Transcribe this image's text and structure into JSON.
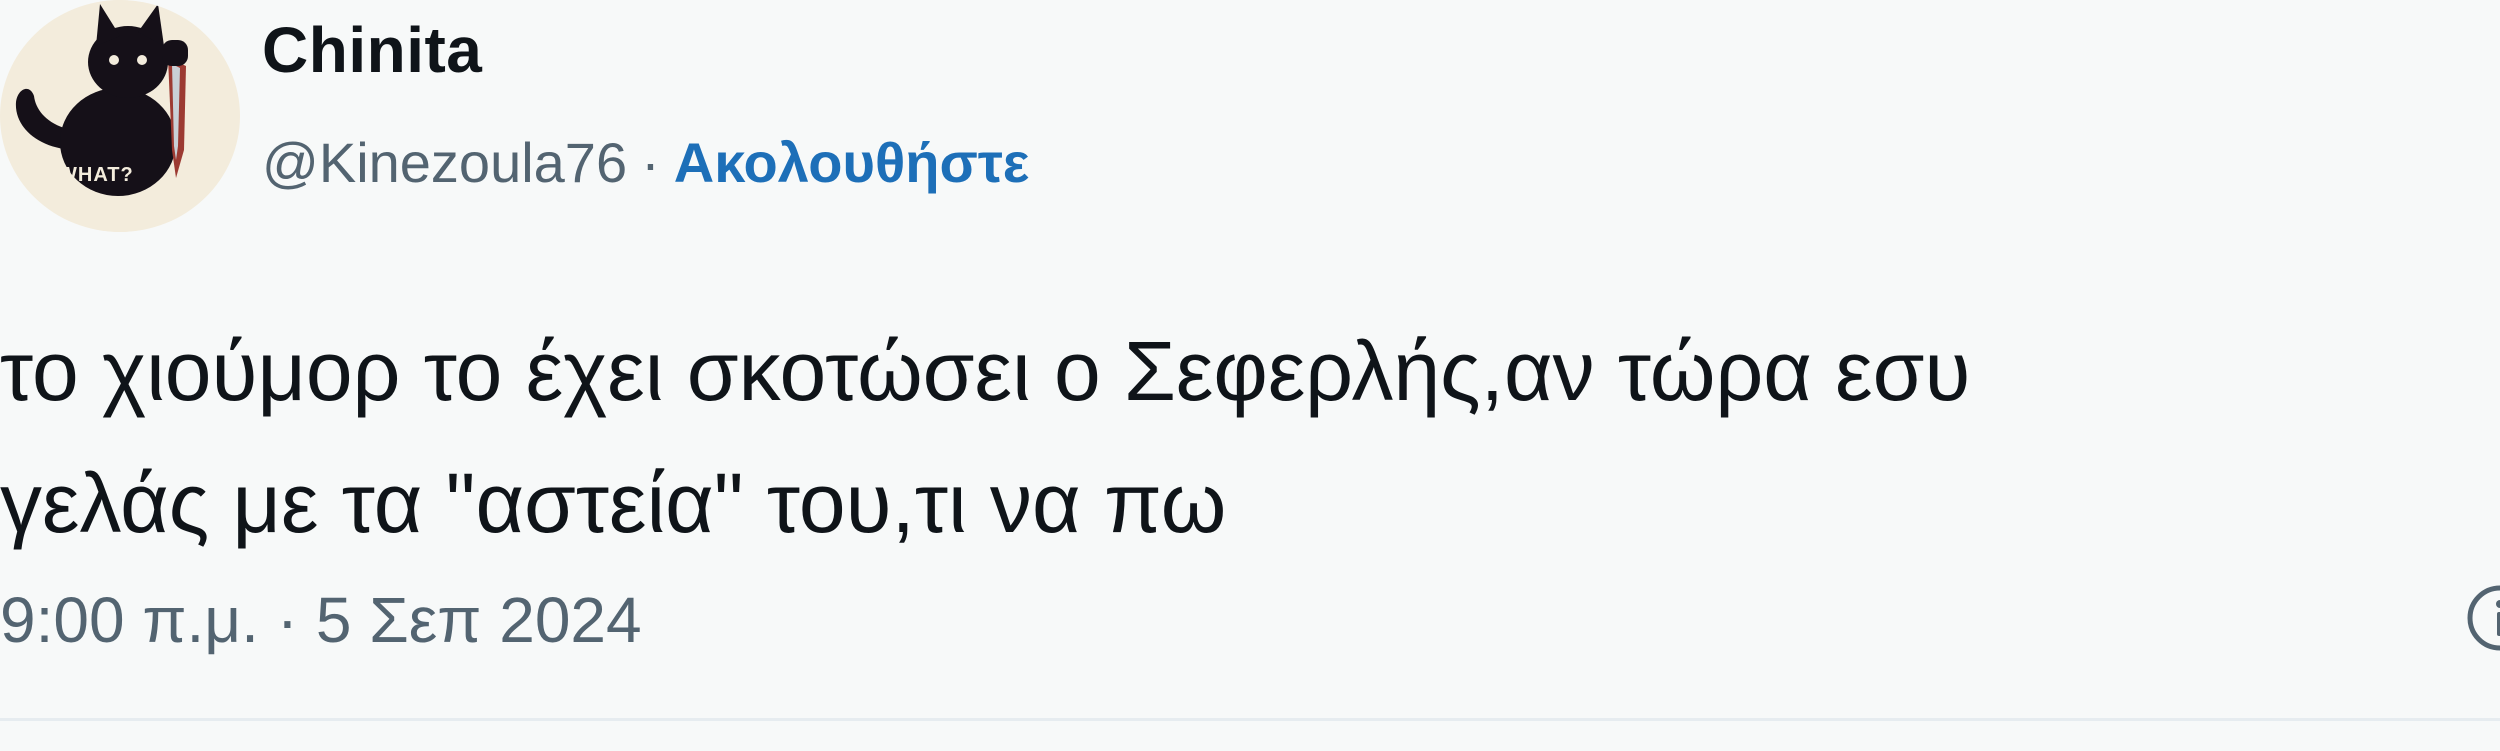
{
  "tweet": {
    "author": {
      "display_name": "Chinita",
      "handle": "@Kinezoula76",
      "avatar_caption": "WHAT?"
    },
    "separator": "·",
    "follow_label": "Ακολουθήστε",
    "text": "το χιούμορ το έχει σκοτώσει ο Σεφερλής,αν τώρα εσυ\nγελάς με τα \"αστεία\" του,τι να πω",
    "timestamp": "9:00 π.μ. · 5 Σεπ 2024"
  },
  "icons": {
    "avatar": "black-cat-with-knife-icon",
    "info": "info-icon"
  },
  "colors": {
    "background": "#f7f9f9",
    "text": "#0f1419",
    "secondary": "#536471",
    "link": "#1d6fb8"
  }
}
